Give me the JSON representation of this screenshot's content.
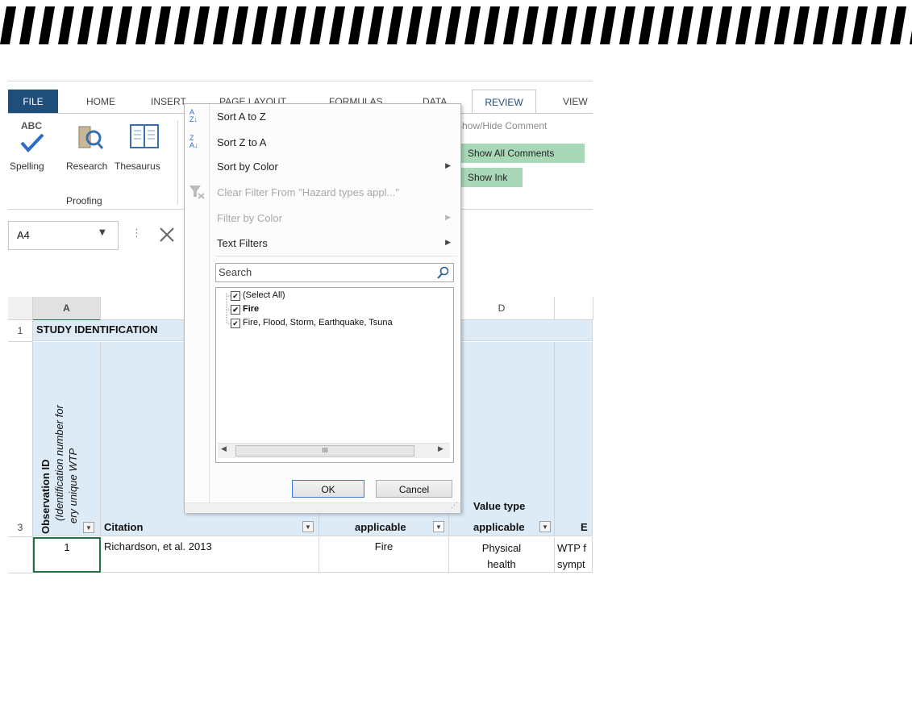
{
  "ribbon": {
    "tabs": {
      "file": "FILE",
      "home": "HOME",
      "insert": "INSERT",
      "page_layout": "PAGE LAYOUT",
      "formulas": "FORMULAS",
      "data": "DATA",
      "review": "REVIEW",
      "view": "VIEW"
    },
    "proofing": {
      "spelling_icon_text": "ABC",
      "spelling": "Spelling",
      "research": "Research",
      "thesaurus": "Thesaurus",
      "group_label": "Proofing"
    },
    "comments": {
      "show_hide": "Show/Hide Comment",
      "show_all": "Show All Comments",
      "show_ink": "Show Ink"
    }
  },
  "formula_bar": {
    "name_box": "A4"
  },
  "sheet": {
    "columns": [
      "A",
      "D"
    ],
    "rows": [
      "1",
      "3"
    ],
    "row1_text": "STUDY IDENTIFICATION",
    "row3": {
      "a_header_bold": "Observation ID",
      "a_header_italic1": "(Identification number for",
      "a_header_italic2": "ery unique WTP",
      "citation": "Citation",
      "c_header": "applicable",
      "d_header1": "Value type",
      "d_header2": "applicable",
      "e_header": "E"
    },
    "data_row": {
      "id": "1",
      "citation": "Richardson, et al. 2013",
      "hazard": "Fire",
      "value_line1": "Physical",
      "value_line2": "health",
      "e_line1": "WTP f",
      "e_line2": "sympt"
    }
  },
  "filter_menu": {
    "sort_az": "Sort A to Z",
    "sort_za": "Sort Z to A",
    "sort_by_color": "Sort by Color",
    "clear_filter": "Clear Filter From \"Hazard types appl...\"",
    "filter_by_color": "Filter by Color",
    "text_filters": "Text Filters",
    "search_placeholder": "Search",
    "items": [
      {
        "label": "(Select All)",
        "checked": true
      },
      {
        "label": "Fire",
        "checked": true
      },
      {
        "label": "Fire, Flood, Storm, Earthquake, Tsuna",
        "checked": true
      }
    ],
    "scroll_thumb": "III",
    "ok": "OK",
    "cancel": "Cancel"
  },
  "colors": {
    "file_tab": "#1e4e79",
    "header_fill": "#ddebf7",
    "highlight": "#a9d8b8"
  }
}
